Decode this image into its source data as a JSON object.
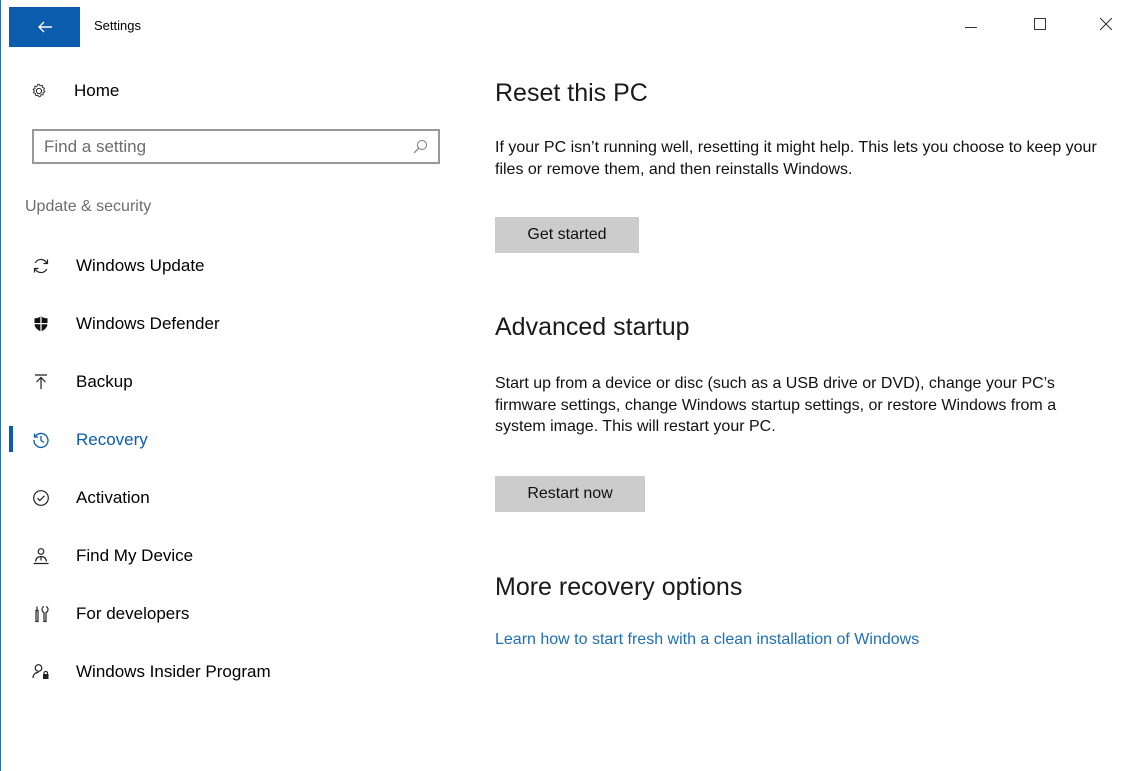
{
  "window": {
    "title": "Settings"
  },
  "sidebar": {
    "home_label": "Home",
    "search_placeholder": "Find a setting",
    "section_heading": "Update & security",
    "items": [
      {
        "label": "Windows Update",
        "icon": "sync-icon"
      },
      {
        "label": "Windows Defender",
        "icon": "shield-icon"
      },
      {
        "label": "Backup",
        "icon": "backup-arrow-icon"
      },
      {
        "label": "Recovery",
        "icon": "history-icon",
        "active": true
      },
      {
        "label": "Activation",
        "icon": "check-circle-icon"
      },
      {
        "label": "Find My Device",
        "icon": "person-pin-icon"
      },
      {
        "label": "For developers",
        "icon": "developer-tools-icon"
      },
      {
        "label": "Windows Insider Program",
        "icon": "insider-icon"
      }
    ]
  },
  "main": {
    "reset": {
      "heading": "Reset this PC",
      "description": "If your PC isn’t running well, resetting it might help. This lets you choose to keep your files or remove them, and then reinstalls Windows.",
      "button": "Get started"
    },
    "advanced": {
      "heading": "Advanced startup",
      "description": "Start up from a device or disc (such as a USB drive or DVD), change your PC’s firmware settings, change Windows startup settings, or restore Windows from a system image. This will restart your PC.",
      "button": "Restart now"
    },
    "more": {
      "heading": "More recovery options",
      "link": "Learn how to start fresh with a clean installation of Windows"
    }
  },
  "colors": {
    "accent": "#0b5cad",
    "link": "#1f6fb4",
    "button_bg": "#cccccc"
  }
}
